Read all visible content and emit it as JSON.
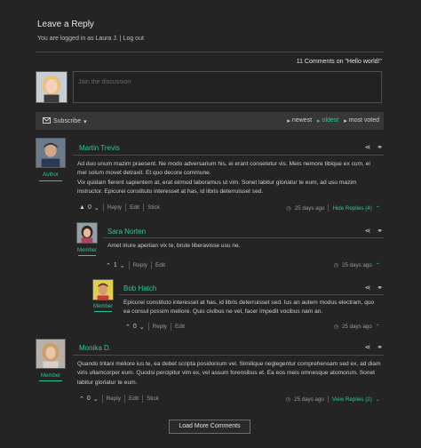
{
  "header": {
    "title": "Leave a Reply",
    "logged_in_prefix": "You are logged in as",
    "logged_in_user": "Laura J.",
    "separator": "|",
    "logout": "Log out"
  },
  "comments_header": {
    "count_text": "11 Comments on \"Hello world!\""
  },
  "reply": {
    "placeholder": "Join the discussion"
  },
  "toolbar": {
    "subscribe": "Subscribe",
    "sort_newest": "newest",
    "sort_oldest": "oldest",
    "sort_most_voted": "most voted"
  },
  "colors": {
    "accent": "#2fc796",
    "background": "#242424",
    "bar": "#373737"
  },
  "icons": {
    "share": "share-icon",
    "link": "link-icon",
    "clock": "clock-icon",
    "envelope": "envelope-icon"
  },
  "comments": [
    {
      "author": "Martin Trevis",
      "badge": "Author",
      "text": "Ad duo unum mazim praesent. Ne modo adversarium his, ei erant consetetur vis. Meis nemore tibique ex cum, ei mel solum movet detraxit. Et quo decore commune.\nVix quidam fierent sapientem at, erat eirmod laboramus ut vim. Sonet labitur gloriatur te eum, ad usu mazim instructor. Epicurei constituto interesset at has, id libris deterruisset sed.",
      "votes": "0",
      "reply": "Reply",
      "edit": "Edit",
      "stick": "Stick",
      "time": "25 days ago",
      "replies_toggle": "Hide Replies (4)"
    },
    {
      "author": "Sara Norten",
      "badge": "Member",
      "text": "Amet iriure aperiian vix te, brute liberavisse usu ne.",
      "votes": "1",
      "reply": "Reply",
      "edit": "Edit",
      "time": "25 days ago"
    },
    {
      "author": "Bob Hatch",
      "badge": "Member",
      "text": "Epicurei constituto interesset at has, id libris deterruisset sed. Ius an autem modus electram, quo ea consul possim meliore. Quis civibus ne vel, facer impedit vocibus nam an.",
      "votes": "0",
      "reply": "Reply",
      "edit": "Edit",
      "time": "25 days ago"
    },
    {
      "author": "Monika D.",
      "badge": "Member",
      "text": "Quando tritani meliore ius te, ea debet scripta posidonium vel. Similique neglegentur comprehensam sed ex, ad diam viris ullamcorper eum. Quodsi percipitur vim ex, vel assum forensibus et. Ea eos meis omnesque atomorum. Sonet labitur gloriatur te eum.",
      "votes": "0",
      "reply": "Reply",
      "edit": "Edit",
      "stick": "Stick",
      "time": "25 days ago",
      "replies_toggle": "View Replies (2)"
    }
  ],
  "load_more": "Load More Comments"
}
